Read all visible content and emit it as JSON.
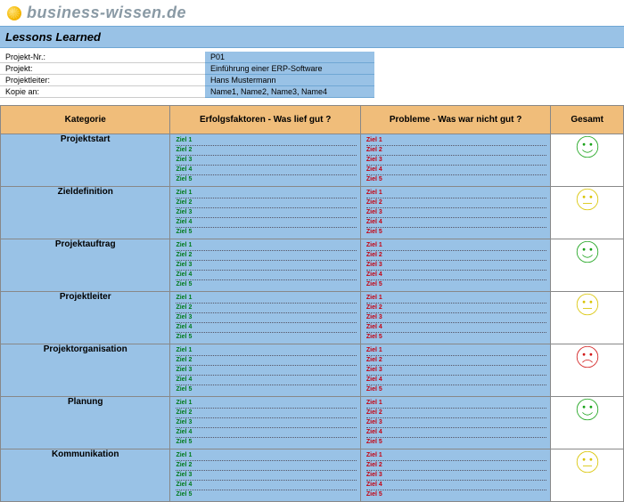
{
  "site": "business-wissen.de",
  "title": "Lessons Learned",
  "meta": {
    "labels": {
      "nr": "Projekt-Nr.:",
      "name": "Projekt:",
      "leader": "Projektleiter:",
      "copy": "Kopie an:"
    },
    "values": {
      "nr": "P01",
      "name": "Einführung einer ERP-Software",
      "leader": "Hans Mustermann",
      "copy": "Name1, Name2, Name3, Name4"
    }
  },
  "columns": {
    "category": "Kategorie",
    "success": "Erfolgsfaktoren - Was lief gut ?",
    "problems": "Probleme - Was war nicht gut ?",
    "total": "Gesamt"
  },
  "ziele": [
    "Ziel 1",
    "Ziel 2",
    "Ziel 3",
    "Ziel 4",
    "Ziel 5"
  ],
  "rows": [
    {
      "category": "Projektstart",
      "mood": "green"
    },
    {
      "category": "Zieldefinition",
      "mood": "yellow"
    },
    {
      "category": "Projektauftrag",
      "mood": "green"
    },
    {
      "category": "Projektleiter",
      "mood": "yellow"
    },
    {
      "category": "Projektorganisation",
      "mood": "red"
    },
    {
      "category": "Planung",
      "mood": "green"
    },
    {
      "category": "Kommunikation",
      "mood": "yellow"
    }
  ],
  "moodColors": {
    "green": "#1aa31a",
    "yellow": "#d9c400",
    "red": "#d11a1a"
  }
}
